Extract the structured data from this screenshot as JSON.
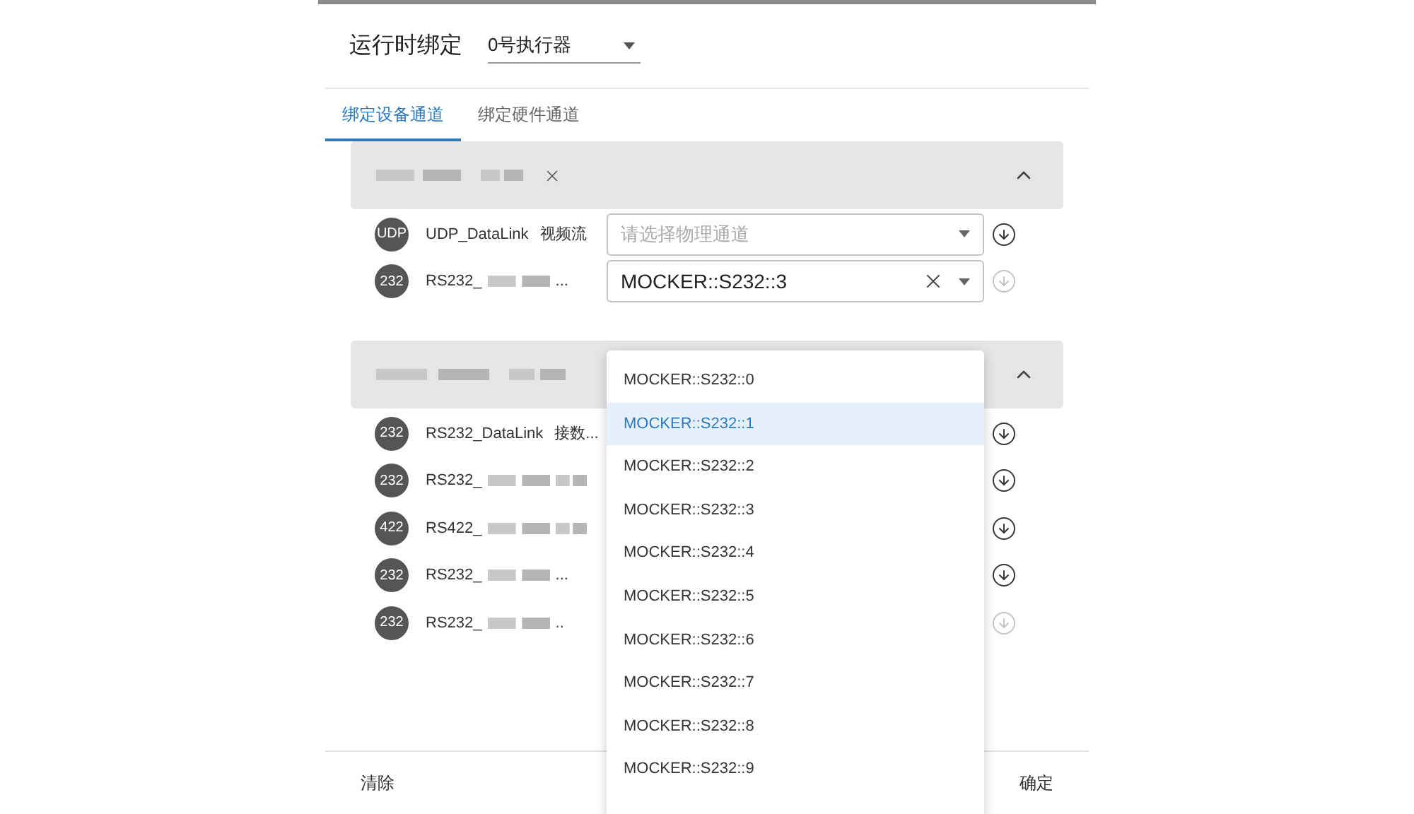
{
  "header": {
    "title": "运行时绑定",
    "executor": "0号执行器"
  },
  "tabs": [
    {
      "label": "绑定设备通道",
      "selected": true
    },
    {
      "label": "绑定硬件通道",
      "selected": false
    }
  ],
  "groups": [
    {
      "closable": true,
      "expanded": true,
      "channels": [
        {
          "badge": "UDP",
          "name": "UDP_DataLink",
          "desc": "视频流",
          "kind": "plain",
          "field": {
            "placeholder": "请选择物理通道"
          },
          "download_disabled": false
        },
        {
          "badge": "232",
          "name": "RS232_",
          "kind": "blurred",
          "suffix": "...",
          "field": {
            "value": "MOCKER::S232::3"
          },
          "download_disabled": true
        }
      ]
    },
    {
      "closable": false,
      "expanded": true,
      "channels": [
        {
          "badge": "232",
          "name": "RS232_DataLink",
          "desc": "接数...",
          "kind": "plain",
          "download_disabled": false
        },
        {
          "badge": "232",
          "name": "RS232_",
          "kind": "blurred",
          "download_disabled": false
        },
        {
          "badge": "422",
          "name": "RS422_",
          "kind": "blurred",
          "download_disabled": false
        },
        {
          "badge": "232",
          "name": "RS232_",
          "kind": "blurred",
          "suffix": "...",
          "download_disabled": false
        },
        {
          "badge": "232",
          "name": "RS232_",
          "kind": "blurred",
          "suffix": "..",
          "download_disabled": true
        }
      ]
    }
  ],
  "dropdown": {
    "options": [
      {
        "label": "MOCKER::S232::0",
        "selected": false
      },
      {
        "label": "MOCKER::S232::1",
        "selected": true
      },
      {
        "label": "MOCKER::S232::2",
        "selected": false
      },
      {
        "label": "MOCKER::S232::3",
        "selected": false
      },
      {
        "label": "MOCKER::S232::4",
        "selected": false
      },
      {
        "label": "MOCKER::S232::5",
        "selected": false
      },
      {
        "label": "MOCKER::S232::6",
        "selected": false
      },
      {
        "label": "MOCKER::S232::7",
        "selected": false
      },
      {
        "label": "MOCKER::S232::8",
        "selected": false
      },
      {
        "label": "MOCKER::S232::9",
        "selected": false
      }
    ]
  },
  "footer": {
    "clear": "清除",
    "confirm": "确定"
  }
}
